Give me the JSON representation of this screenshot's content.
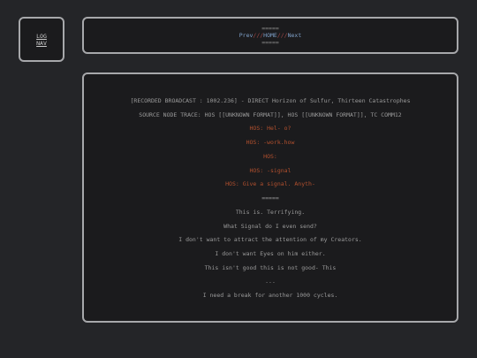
{
  "log_nav": {
    "line1": "LOG",
    "line2": "NAV"
  },
  "nav": {
    "separator": "=====",
    "prev_label": "Prev",
    "slash1": "///",
    "home_label": "HOME",
    "slash2": "///",
    "next_label": "Next"
  },
  "content": {
    "lines": [
      "[RECORDED BROADCAST : 1002.236] - DIRECT Horizon of Sulfur, Thirteen Catastrophes",
      "SOURCE NODE TRACE: HOS [[UNKNOWN FORMAT]], HOS [[UNKNOWN FORMAT]], TC COMM12",
      "HOS: Hel- o?",
      "HOS: -work.how",
      "HOS:",
      "HOS: -signal",
      "HOS: Give a signal. Anyth-",
      "=====",
      "This is. Terrifying.",
      "What Signal do I even send?",
      "I don't want to attract the attention of my Creators.",
      "I don't want Eyes on him either.",
      "This isn't good this is not good- This",
      "...",
      "I need a break for another 1000 cycles."
    ]
  },
  "colors": {
    "background": "#242528",
    "box_fill": "#1b1b1d",
    "border": "#a7a8ab",
    "text_gray": "#9a9a9a",
    "text_red": "#b2502e",
    "link_blue": "#7fa0c8",
    "slash_red": "#a04848"
  }
}
